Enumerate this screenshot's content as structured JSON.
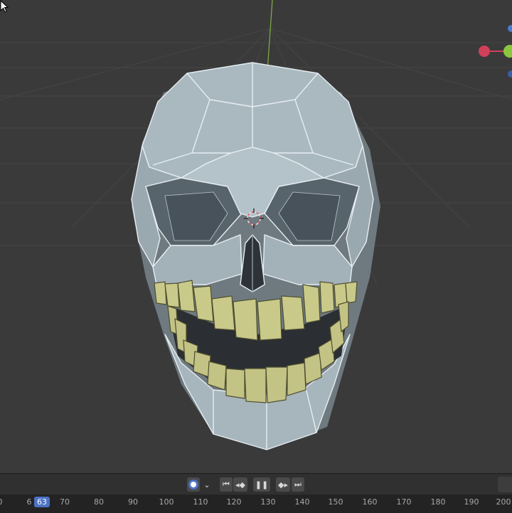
{
  "viewport": {
    "background": "#3a3a3a",
    "skull_color": "#a6b4bc",
    "teeth_color": "#c9c98a",
    "axis_gizmo": {
      "x_color": "#d0405a",
      "y_color": "#8cc63f",
      "z_color": "#4a7ad0"
    }
  },
  "timeline": {
    "current_frame": "63",
    "ticks": [
      "0",
      "6",
      "70",
      "80",
      "90",
      "100",
      "110",
      "120",
      "130",
      "140",
      "150",
      "160",
      "170",
      "180",
      "190",
      "200"
    ],
    "controls": {
      "keying_icon": "record-dot-icon",
      "dropdown_icon": "chevron-down-icon",
      "jump_start_icon": "jump-to-start-icon",
      "prev_key_icon": "prev-keyframe-icon",
      "pause_icon": "pause-icon",
      "next_key_icon": "next-keyframe-icon",
      "jump_end_icon": "jump-to-end-icon"
    }
  }
}
